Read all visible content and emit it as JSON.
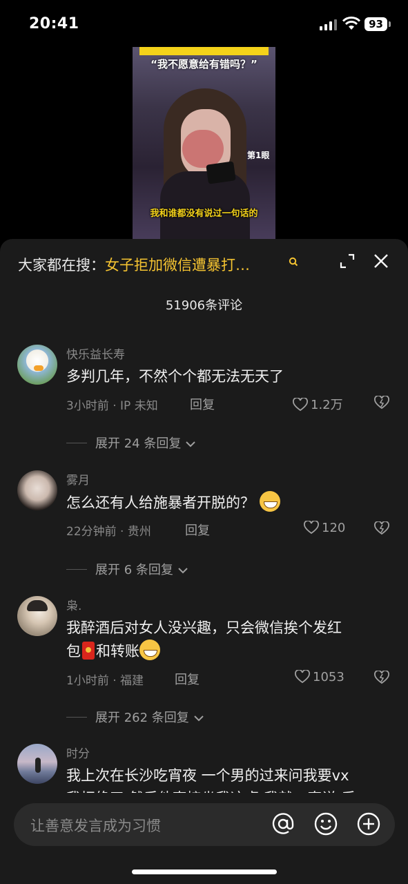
{
  "status_bar": {
    "time": "20:41",
    "battery": "93"
  },
  "video": {
    "title": "“我不愿意给有错吗？”",
    "subtitle": "我和谁都没有说过一句话的",
    "logo": "第1眼"
  },
  "search": {
    "prefix": "大家都在搜：",
    "term": "女子拒加微信遭暴打…"
  },
  "comments_count": "51906条评论",
  "comments": [
    {
      "user": "快乐益长寿",
      "text": "多判几年，不然个个都无法无天了",
      "time": "3小时前 · IP 未知",
      "reply": "回复",
      "likes": "1.2万",
      "expand": "展开 24 条回复"
    },
    {
      "user": "雾月",
      "text": "怎么还有人给施暴者开脱的？",
      "time": "22分钟前 · 贵州",
      "reply": "回复",
      "likes": "120",
      "expand": "展开 6 条回复"
    },
    {
      "user": "枭.",
      "text_line1": "我醉酒后对女人没兴趣，只会微信挨个发红",
      "text_line2_a": "包",
      "text_line2_b": "和转账",
      "time": "1小时前 · 福建",
      "reply": "回复",
      "likes": "1053",
      "expand": "展开 262 条回复"
    },
    {
      "user": "时分",
      "text_line1": "我上次在长沙吃宵夜 一个男的过来问我要vx",
      "text_line2": "我拒绝了 然后他直接坐我这桌 我就一直说 后"
    }
  ],
  "input": {
    "placeholder": "让善意发言成为习惯"
  },
  "colors": {
    "accent": "#f6c431",
    "sheet_bg": "#1b1b1b"
  }
}
